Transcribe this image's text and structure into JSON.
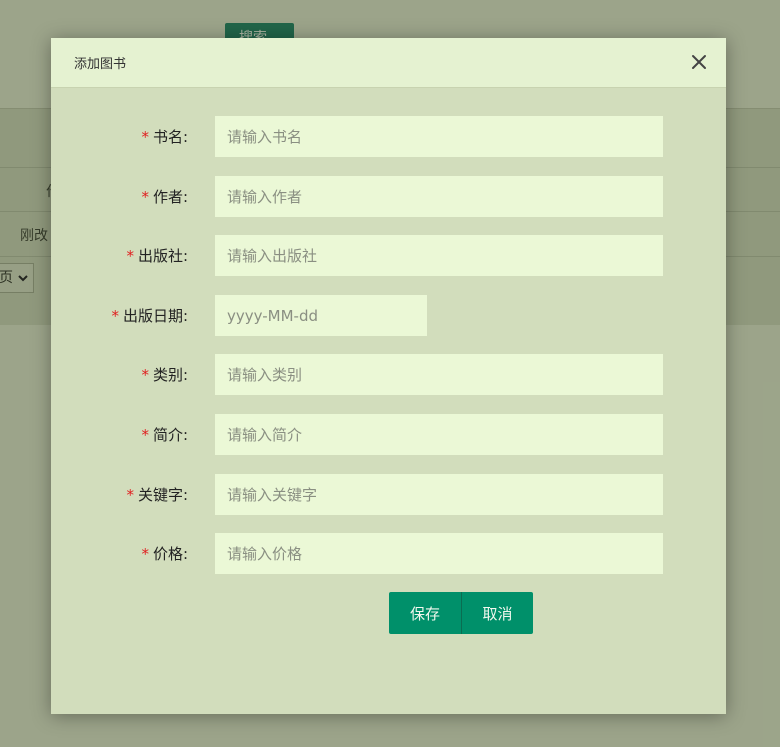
{
  "background": {
    "search_button": "搜索",
    "table_cell_1": "刚改",
    "table_header_fragment": "作",
    "page_select": "页"
  },
  "modal": {
    "title": "添加图书",
    "fields": [
      {
        "label": "书名:",
        "placeholder": "请输入书名",
        "required": true
      },
      {
        "label": "作者:",
        "placeholder": "请输入作者",
        "required": true
      },
      {
        "label": "出版社:",
        "placeholder": "请输入出版社",
        "required": true
      },
      {
        "label": "出版日期:",
        "placeholder": "yyyy-MM-dd",
        "required": true
      },
      {
        "label": "类别:",
        "placeholder": "请输入类别",
        "required": true
      },
      {
        "label": "简介:",
        "placeholder": "请输入简介",
        "required": true
      },
      {
        "label": "关键字:",
        "placeholder": "请输入关键字",
        "required": true
      },
      {
        "label": "价格:",
        "placeholder": "请输入价格",
        "required": true
      }
    ],
    "required_mark": "*",
    "buttons": {
      "save": "保存",
      "cancel": "取消"
    }
  },
  "colors": {
    "primary": "#00906a",
    "required": "#e02020",
    "modal_body": "#d2ddbc",
    "modal_header": "#e5f2d1",
    "input_bg": "#ebf8d6"
  },
  "icons": {
    "close": "close-icon",
    "search": "search-icon",
    "dropdown": "chevron-down-icon"
  }
}
